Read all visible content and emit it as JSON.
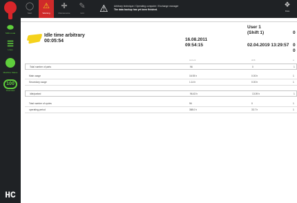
{
  "sidebar": {
    "items": [
      {
        "symbol": "⬬",
        "label": "Shift mode"
      },
      {
        "symbol": "☰",
        "label": "Lines"
      },
      {
        "symbol": "",
        "label": "Machine Status"
      },
      {
        "symbol": "100",
        "label": "Overview"
      }
    ],
    "footer": "HC"
  },
  "topbar": {
    "buttons": [
      {
        "label": "Start"
      },
      {
        "label": "Warning"
      },
      {
        "label": "Maintenance"
      },
      {
        "label": "Unit"
      }
    ],
    "warning_line1": "Arbitrary technique / Operating computer / Exchange manager",
    "warning_line2": "The data backup has yet been finished.",
    "right_label": "Data"
  },
  "report": {
    "title_label": "Idle time arbitrary",
    "title_value": "00:05:54",
    "columns": [
      {
        "line1": "",
        "line2": "16.08.2011",
        "line3": "09:54:15",
        "sub": "current"
      },
      {
        "line1": "User 1",
        "line2": "(Shift 1)",
        "line3": "02.04.2019 13:29:57",
        "sub": "shift"
      },
      {
        "line1": "0",
        "line2": "0",
        "line3": "0",
        "sub": "a"
      }
    ],
    "rows": [
      {
        "label": "Total number of parts",
        "c1": "96",
        "c2": "0",
        "c3": "1"
      },
      {
        "label": "Main usage",
        "c1": "16.93 h",
        "c2": "0.00 h",
        "c3": "1"
      },
      {
        "label": "Secondary usage",
        "c1": "1.14 h",
        "c2": "0.00 h",
        "c3": "1"
      },
      {
        "label": "Idle/parked",
        "c1": "96.43 h",
        "c2": "13.09 h",
        "c3": "1"
      },
      {
        "label": "Total number of cycles",
        "c1": "96",
        "c2": "0",
        "c3": "1"
      },
      {
        "label": "operating period",
        "c1": "388.0 h",
        "c2": "33.7 h",
        "c3": "1"
      }
    ]
  },
  "colors": {
    "bar": "#1f2225",
    "accent_red": "#cf2a2a",
    "accent_green": "#5fcf3c",
    "accent_yellow": "#f5d21c"
  }
}
